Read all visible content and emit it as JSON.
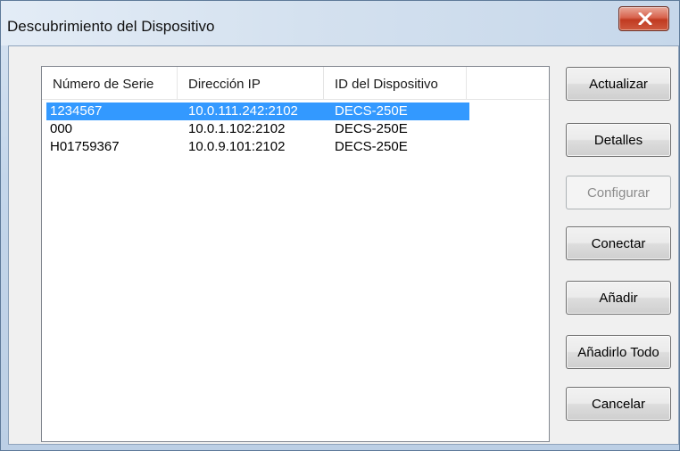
{
  "window": {
    "title": "Descubrimiento del Dispositivo",
    "close_glyph": "✕"
  },
  "list": {
    "columns": [
      "Número de Serie",
      "Dirección IP",
      "ID del Dispositivo"
    ],
    "rows": [
      {
        "serial": "1234567",
        "ip": "10.0.111.242:2102",
        "device_id": "DECS-250E",
        "selected": true
      },
      {
        "serial": "000",
        "ip": "10.0.1.102:2102",
        "device_id": "DECS-250E",
        "selected": false
      },
      {
        "serial": "H01759367",
        "ip": "10.0.9.101:2102",
        "device_id": "DECS-250E",
        "selected": false
      }
    ]
  },
  "buttons": {
    "actualizar": "Actualizar",
    "detalles": "Detalles",
    "configurar": "Configurar",
    "conectar": "Conectar",
    "anadir": "Añadir",
    "anadir_todo": "Añadirlo Todo",
    "cancelar": "Cancelar"
  },
  "colors": {
    "selection": "#3399ff",
    "close_button": "#c8432a",
    "window_frame": "#c4d6ea"
  },
  "icons": {
    "close": "close-icon"
  }
}
